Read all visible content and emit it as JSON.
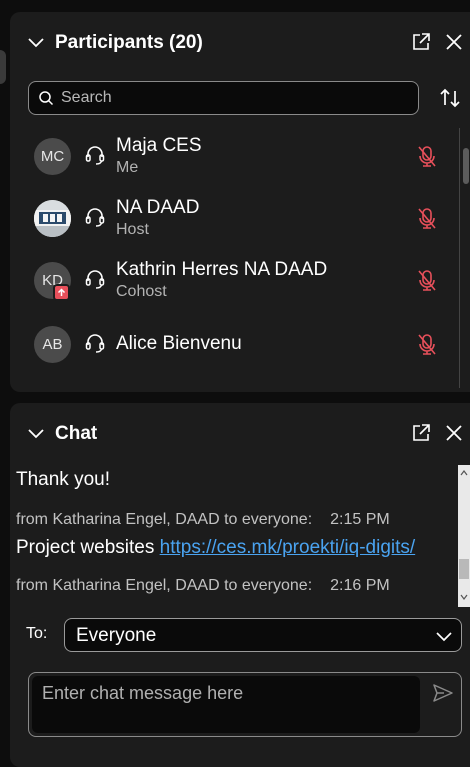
{
  "participants": {
    "title": "Participants (20)",
    "search_placeholder": "Search",
    "list": [
      {
        "initials": "MC",
        "name": "Maja CES",
        "role": "Me",
        "avatar": "initials"
      },
      {
        "initials": "",
        "name": "NA DAAD",
        "role": "Host",
        "avatar": "photo"
      },
      {
        "initials": "KD",
        "name": "Kathrin Herres NA DAAD",
        "role": "Cohost",
        "avatar": "initials",
        "sharing": true
      },
      {
        "initials": "AB",
        "name": "Alice Bienvenu",
        "role": "",
        "avatar": "initials"
      }
    ]
  },
  "chat": {
    "title": "Chat",
    "messages": [
      {
        "text": "Thank you!"
      },
      {
        "meta": "from Katharina Engel, DAAD to everyone:",
        "time": "2:15 PM"
      },
      {
        "text": "Project websites ",
        "link": "https://ces.mk/proekti/iq-digits/"
      },
      {
        "meta": "from Katharina Engel, DAAD to everyone:",
        "time": "2:16 PM"
      }
    ],
    "to_label": "To:",
    "to_value": "Everyone",
    "input_placeholder": "Enter chat message here"
  },
  "colors": {
    "panel_bg": "#1c1c1c",
    "muted_red": "#e8505b",
    "link_blue": "#4aa3f0"
  },
  "icons": [
    "chevron-down-icon",
    "popout-icon",
    "close-icon",
    "search-icon",
    "sort-icon",
    "headset-icon",
    "muted-mic-icon",
    "screen-share-icon",
    "send-icon"
  ]
}
